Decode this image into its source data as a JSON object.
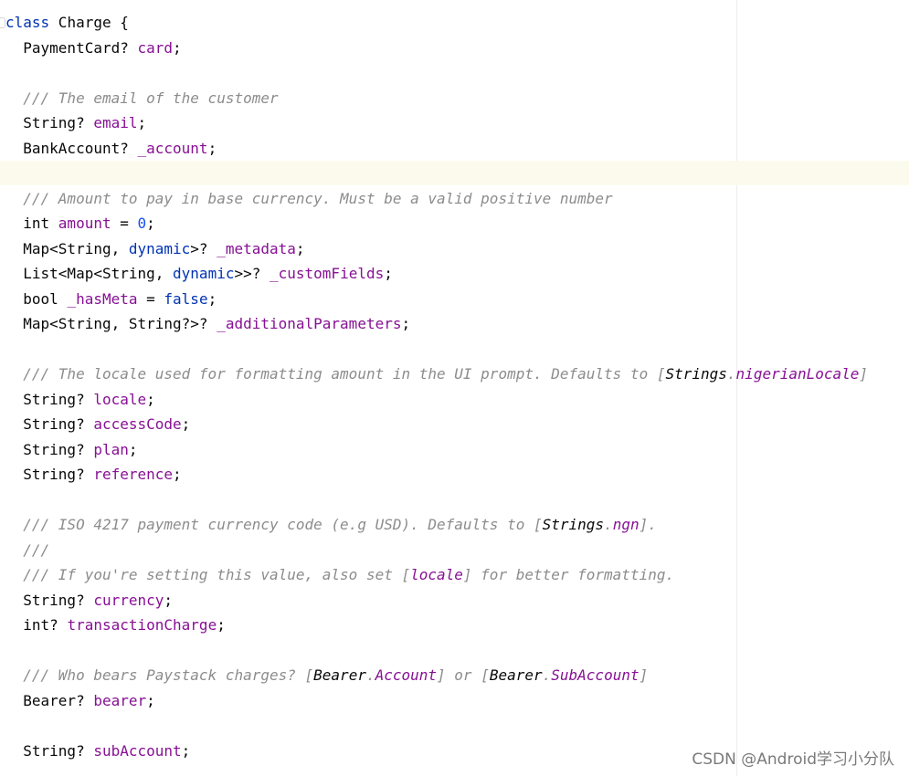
{
  "editor": {
    "colors": {
      "background": "#ffffff",
      "caret_line": "#fcfaed",
      "keyword": "#0033b3",
      "field": "#871094",
      "number": "#1750eb",
      "comment": "#8c8c8c",
      "text": "#080808"
    },
    "caret_line_index": 6,
    "lines": [
      [
        {
          "t": "class",
          "c": "kw"
        },
        {
          "t": " Charge {"
        }
      ],
      [
        {
          "t": "  PaymentCard? "
        },
        {
          "t": "card",
          "c": "field"
        },
        {
          "t": ";"
        }
      ],
      [],
      [
        {
          "t": "  /// The email of the customer",
          "c": "comment"
        }
      ],
      [
        {
          "t": "  String? "
        },
        {
          "t": "email",
          "c": "field"
        },
        {
          "t": ";"
        }
      ],
      [
        {
          "t": "  BankAccount? "
        },
        {
          "t": "_account",
          "c": "field"
        },
        {
          "t": ";"
        }
      ],
      [],
      [
        {
          "t": "  /// Amount to pay in base currency. Must be a valid positive number",
          "c": "comment"
        }
      ],
      [
        {
          "t": "  int "
        },
        {
          "t": "amount",
          "c": "field"
        },
        {
          "t": " = "
        },
        {
          "t": "0",
          "c": "num"
        },
        {
          "t": ";"
        }
      ],
      [
        {
          "t": "  Map<String, "
        },
        {
          "t": "dynamic",
          "c": "kw"
        },
        {
          "t": ">? "
        },
        {
          "t": "_metadata",
          "c": "field"
        },
        {
          "t": ";"
        }
      ],
      [
        {
          "t": "  List<Map<String, "
        },
        {
          "t": "dynamic",
          "c": "kw"
        },
        {
          "t": ">>? "
        },
        {
          "t": "_customFields",
          "c": "field"
        },
        {
          "t": ";"
        }
      ],
      [
        {
          "t": "  bool "
        },
        {
          "t": "_hasMeta",
          "c": "field"
        },
        {
          "t": " = "
        },
        {
          "t": "false",
          "c": "kw"
        },
        {
          "t": ";"
        }
      ],
      [
        {
          "t": "  Map<String, String?>? "
        },
        {
          "t": "_additionalParameters",
          "c": "field"
        },
        {
          "t": ";"
        }
      ],
      [],
      [
        {
          "t": "  /// The locale used for formatting amount in the UI prompt. Defaults to [",
          "c": "comment"
        },
        {
          "t": "Strings",
          "c": "ref"
        },
        {
          "t": ".",
          "c": "comment"
        },
        {
          "t": "nigerianLocale",
          "c": "refmember"
        },
        {
          "t": "]",
          "c": "comment"
        }
      ],
      [
        {
          "t": "  String? "
        },
        {
          "t": "locale",
          "c": "field"
        },
        {
          "t": ";"
        }
      ],
      [
        {
          "t": "  String? "
        },
        {
          "t": "accessCode",
          "c": "field"
        },
        {
          "t": ";"
        }
      ],
      [
        {
          "t": "  String? "
        },
        {
          "t": "plan",
          "c": "field"
        },
        {
          "t": ";"
        }
      ],
      [
        {
          "t": "  String? "
        },
        {
          "t": "reference",
          "c": "field"
        },
        {
          "t": ";"
        }
      ],
      [],
      [
        {
          "t": "  /// ISO 4217 payment currency code (e.g USD). Defaults to [",
          "c": "comment"
        },
        {
          "t": "Strings",
          "c": "ref"
        },
        {
          "t": ".",
          "c": "comment"
        },
        {
          "t": "ngn",
          "c": "refmember"
        },
        {
          "t": "].",
          "c": "comment"
        }
      ],
      [
        {
          "t": "  ///",
          "c": "comment"
        }
      ],
      [
        {
          "t": "  /// If you're setting this value, also set [",
          "c": "comment"
        },
        {
          "t": "locale",
          "c": "refmember"
        },
        {
          "t": "] for better formatting.",
          "c": "comment"
        }
      ],
      [
        {
          "t": "  String? "
        },
        {
          "t": "currency",
          "c": "field"
        },
        {
          "t": ";"
        }
      ],
      [
        {
          "t": "  int? "
        },
        {
          "t": "transactionCharge",
          "c": "field"
        },
        {
          "t": ";"
        }
      ],
      [],
      [
        {
          "t": "  /// Who bears Paystack charges? [",
          "c": "comment"
        },
        {
          "t": "Bearer",
          "c": "ref"
        },
        {
          "t": ".",
          "c": "comment"
        },
        {
          "t": "Account",
          "c": "refmember"
        },
        {
          "t": "] or [",
          "c": "comment"
        },
        {
          "t": "Bearer",
          "c": "ref"
        },
        {
          "t": ".",
          "c": "comment"
        },
        {
          "t": "SubAccount",
          "c": "refmember"
        },
        {
          "t": "]",
          "c": "comment"
        }
      ],
      [
        {
          "t": "  Bearer? "
        },
        {
          "t": "bearer",
          "c": "field"
        },
        {
          "t": ";"
        }
      ],
      [],
      [
        {
          "t": "  String? "
        },
        {
          "t": "subAccount",
          "c": "field"
        },
        {
          "t": ";"
        }
      ]
    ]
  },
  "watermark": {
    "text": "CSDN @Android学习小分队"
  }
}
